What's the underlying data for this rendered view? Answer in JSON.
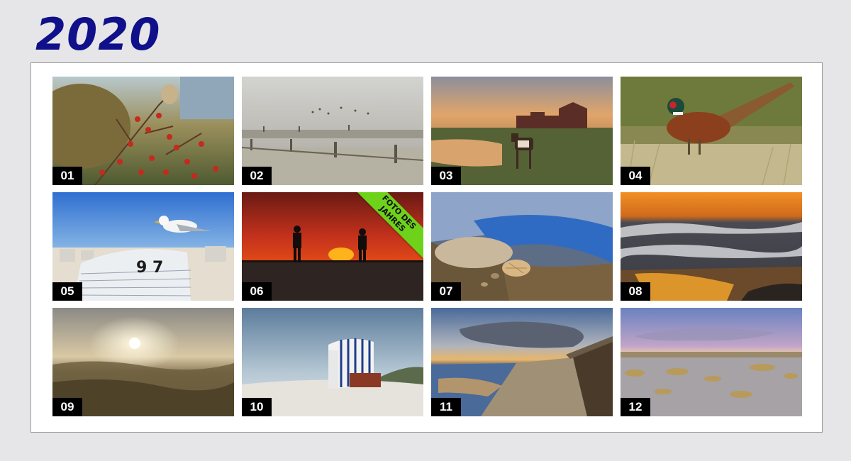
{
  "calendar": {
    "year": "2020",
    "months": [
      {
        "num": "01",
        "icon": "rosehip-bush-photo"
      },
      {
        "num": "02",
        "icon": "foggy-mudflat-fence-photo"
      },
      {
        "num": "03",
        "icon": "pony-at-sunset-village-photo"
      },
      {
        "num": "04",
        "icon": "pheasant-photo"
      },
      {
        "num": "05",
        "icon": "seagull-on-beach-chair-photo"
      },
      {
        "num": "06",
        "icon": "sunset-silhouettes-photo"
      },
      {
        "num": "07",
        "icon": "shells-in-tidal-pool-photo"
      },
      {
        "num": "08",
        "icon": "sunset-waves-photo"
      },
      {
        "num": "09",
        "icon": "misty-dunes-sunrise-photo"
      },
      {
        "num": "10",
        "icon": "striped-beach-chair-photo"
      },
      {
        "num": "11",
        "icon": "beach-path-dramatic-sky-photo"
      },
      {
        "num": "12",
        "icon": "dune-grass-evening-photo"
      }
    ],
    "badge": "FOTO DES\nJAHRES"
  }
}
